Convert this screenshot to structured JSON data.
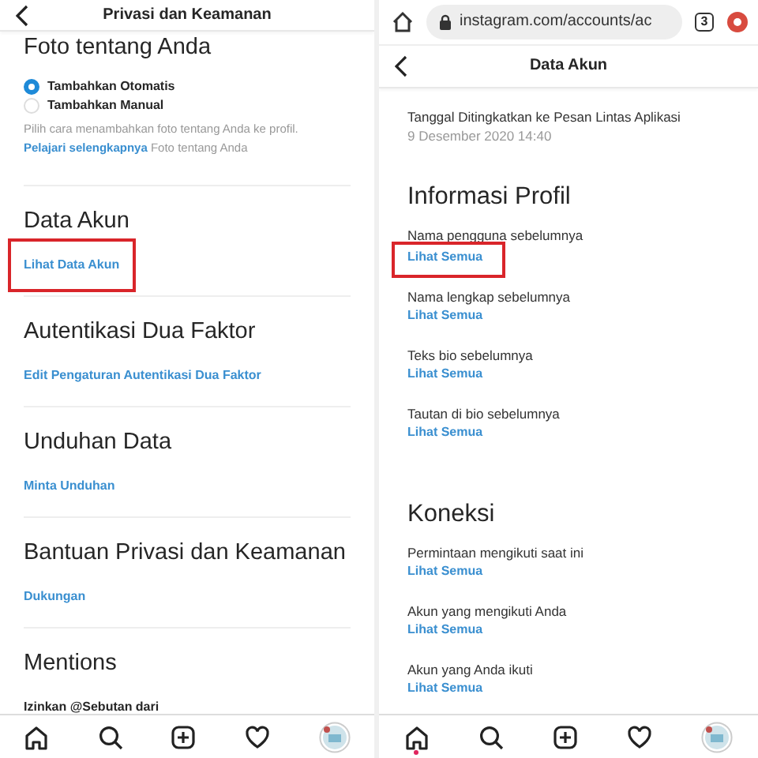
{
  "left": {
    "title": "Privasi dan Keamanan",
    "photo_section": {
      "heading": "Foto tentang Anda",
      "options": [
        {
          "label": "Tambahkan Otomatis",
          "selected": true
        },
        {
          "label": "Tambahkan Manual",
          "selected": false
        }
      ],
      "hint": "Pilih cara menambahkan foto tentang Anda ke profil.",
      "note_link": "Pelajari selengkapnya",
      "note_text": "Foto tentang Anda"
    },
    "sections": [
      {
        "heading": "Data Akun",
        "link": "Lihat Data Akun",
        "highlighted": true
      },
      {
        "heading": "Autentikasi Dua Faktor",
        "link": "Edit Pengaturan Autentikasi Dua Faktor",
        "highlighted": false
      },
      {
        "heading": "Unduhan Data",
        "link": "Minta Unduhan",
        "highlighted": false
      },
      {
        "heading": "Bantuan Privasi dan Keamanan",
        "link": "Dukungan",
        "highlighted": false
      },
      {
        "heading": "Mentions",
        "subheading": "Izinkan @Sebutan dari",
        "highlighted": false
      }
    ],
    "nav": [
      {
        "kind": "home",
        "dot": false
      },
      {
        "kind": "search"
      },
      {
        "kind": "add"
      },
      {
        "kind": "heart"
      },
      {
        "kind": "avatar"
      }
    ]
  },
  "right": {
    "browser": {
      "url": "instagram.com/accounts/ac",
      "tab_count": "3"
    },
    "title": "Data Akun",
    "info": {
      "label": "Tanggal Ditingkatkan ke Pesan Lintas Aplikasi",
      "value": "9 Desember 2020 14:40"
    },
    "sections": [
      {
        "heading": "Informasi Profil",
        "items": [
          {
            "label": "Nama pengguna sebelumnya",
            "link": "Lihat Semua",
            "highlighted": true
          },
          {
            "label": "Nama lengkap sebelumnya",
            "link": "Lihat Semua",
            "highlighted": false
          },
          {
            "label": "Teks bio sebelumnya",
            "link": "Lihat Semua",
            "highlighted": false
          },
          {
            "label": "Tautan di bio sebelumnya",
            "link": "Lihat Semua",
            "highlighted": false
          }
        ]
      },
      {
        "heading": "Koneksi",
        "items": [
          {
            "label": "Permintaan mengikuti saat ini",
            "link": "Lihat Semua",
            "highlighted": false
          },
          {
            "label": "Akun yang mengikuti Anda",
            "link": "Lihat Semua",
            "highlighted": false
          },
          {
            "label": "Akun yang Anda ikuti",
            "link": "Lihat Semua",
            "highlighted": false
          }
        ]
      }
    ],
    "nav": [
      {
        "kind": "home",
        "dot": true
      },
      {
        "kind": "search"
      },
      {
        "kind": "add"
      },
      {
        "kind": "heart"
      },
      {
        "kind": "avatar"
      }
    ]
  }
}
